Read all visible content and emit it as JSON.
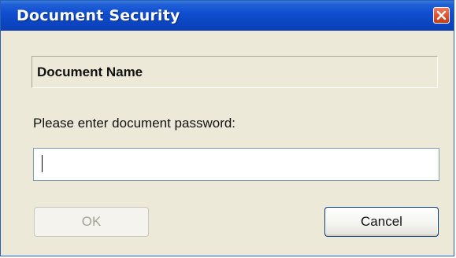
{
  "window": {
    "title": "Document Security",
    "close_icon": "close-icon"
  },
  "dialog": {
    "document_name": "Document Name",
    "prompt": "Please enter document password:",
    "password_value": "",
    "ok_label": "OK",
    "cancel_label": "Cancel",
    "ok_enabled": false
  },
  "colors": {
    "titlebar": "#0c46c2",
    "close_button": "#e0502c",
    "client_background": "#ece9d8"
  }
}
